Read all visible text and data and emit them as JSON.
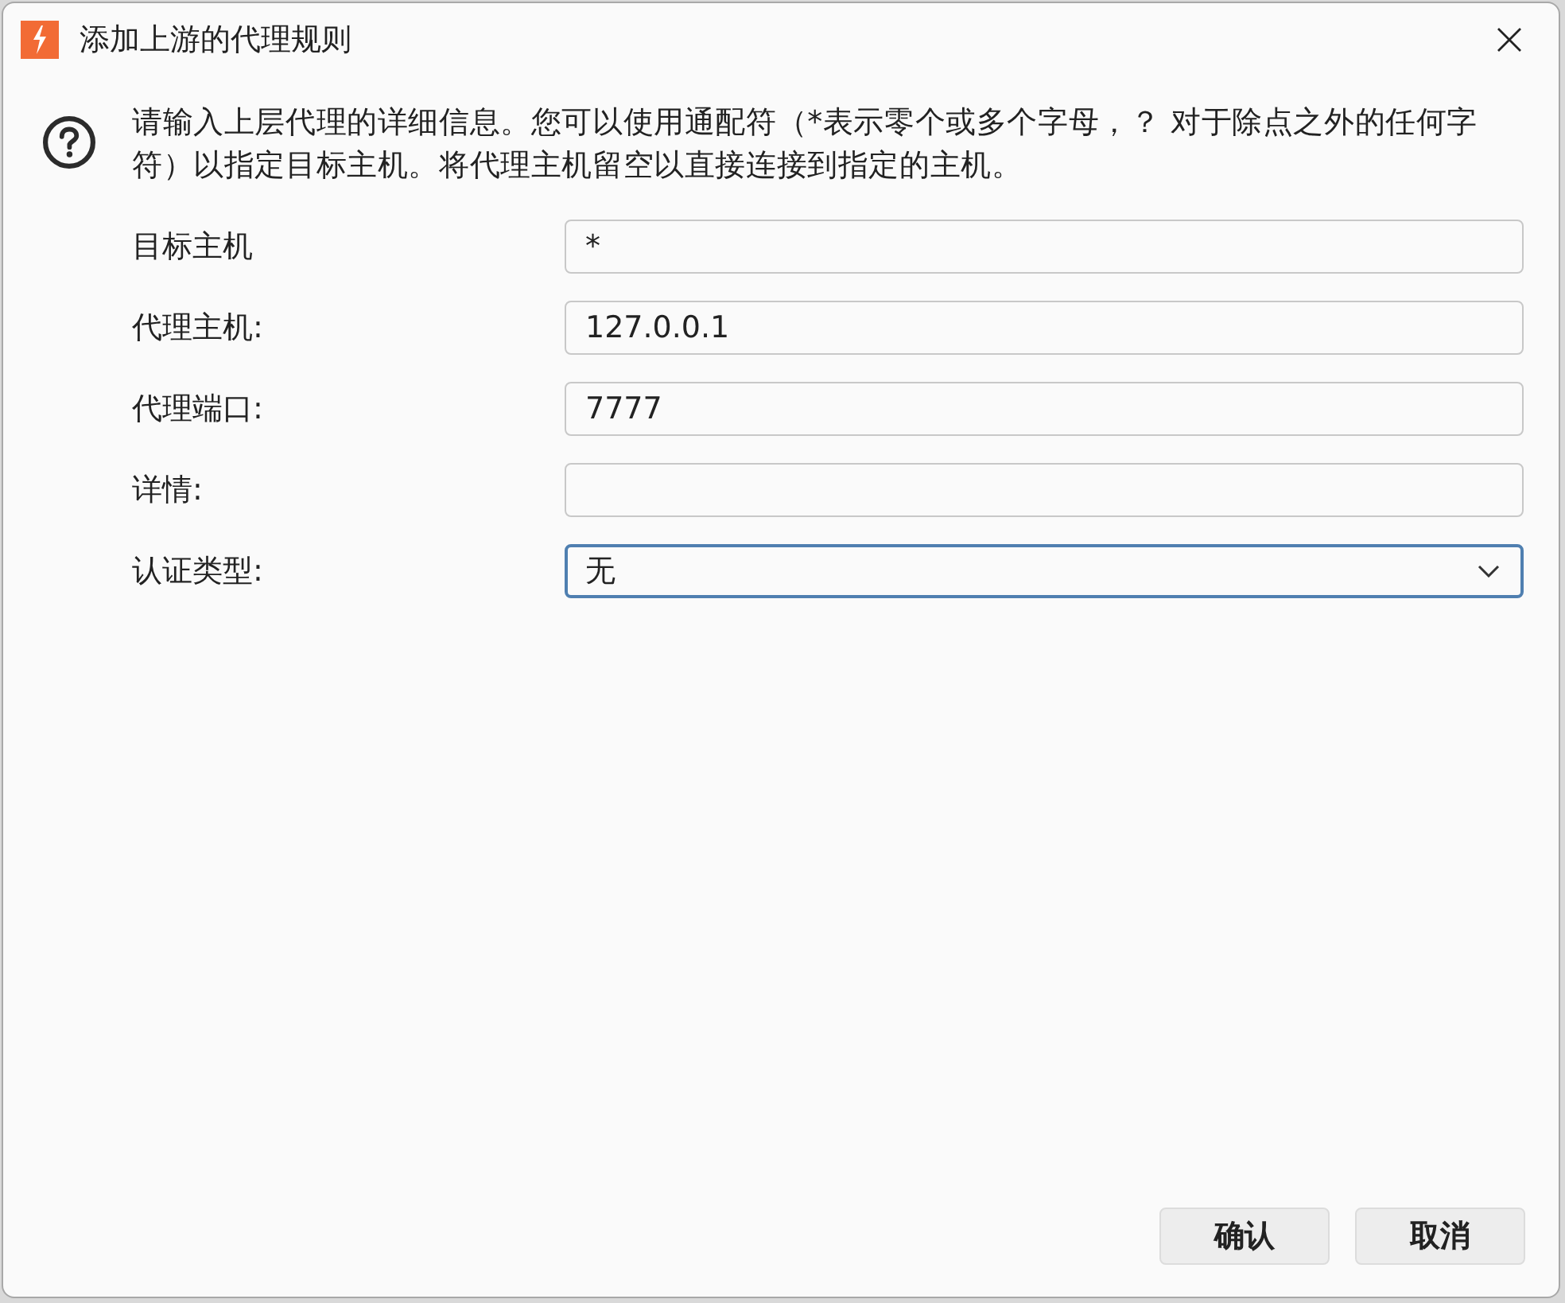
{
  "window": {
    "title": "添加上游的代理规则"
  },
  "description": "请输入上层代理的详细信息。您可以使用通配符（*表示零个或多个字母，？ 对于除点之外的任何字符）以指定目标主机。将代理主机留空以直接连接到指定的主机。",
  "fields": [
    {
      "label": "目标主机",
      "kind": "text",
      "value": "*",
      "focused": false
    },
    {
      "label": "代理主机:",
      "kind": "text",
      "value": "127.0.0.1",
      "focused": false
    },
    {
      "label": "代理端口:",
      "kind": "text",
      "value": "7777",
      "focused": false
    },
    {
      "label": "详情:",
      "kind": "text",
      "focused": false
    },
    {
      "label": "认证类型:",
      "kind": "select",
      "value": "无",
      "focused": true
    }
  ],
  "buttons": [
    "确认",
    "取消"
  ]
}
